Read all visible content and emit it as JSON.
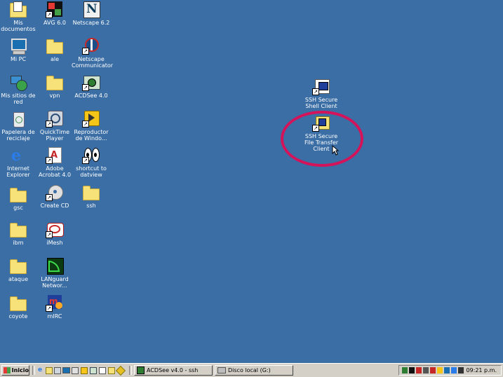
{
  "desktop": {
    "icons": [
      {
        "label": "Mis\ndocumentos",
        "icon": "my-documents-icon"
      },
      {
        "label": "Mi PC",
        "icon": "my-computer-icon"
      },
      {
        "label": "Mis sitios de\nred",
        "icon": "network-places-icon"
      },
      {
        "label": "Papelera de\nreciclaje",
        "icon": "recycle-bin-icon"
      },
      {
        "label": "Internet\nExplorer",
        "icon": "internet-explorer-icon"
      },
      {
        "label": "gsc",
        "icon": "folder-icon"
      },
      {
        "label": "ibm",
        "icon": "folder-icon"
      },
      {
        "label": "ataque",
        "icon": "folder-icon"
      },
      {
        "label": "coyote",
        "icon": "folder-icon"
      },
      {
        "label": "AVG 6.0",
        "icon": "avg-icon"
      },
      {
        "label": "ale",
        "icon": "folder-icon"
      },
      {
        "label": "vpn",
        "icon": "folder-icon"
      },
      {
        "label": "QuickTime\nPlayer",
        "icon": "quicktime-icon"
      },
      {
        "label": "Adobe\nAcrobat 4.0",
        "icon": "acrobat-icon"
      },
      {
        "label": "Create CD",
        "icon": "create-cd-icon"
      },
      {
        "label": "iMesh",
        "icon": "imesh-icon"
      },
      {
        "label": "LANguard\nNetwor...",
        "icon": "languard-icon"
      },
      {
        "label": "mIRC",
        "icon": "mirc-icon"
      },
      {
        "label": "Netscape 6.2",
        "icon": "netscape-icon"
      },
      {
        "label": "Netscape\nCommunicator",
        "icon": "netscape-communicator-icon"
      },
      {
        "label": "ACDSee 4.0",
        "icon": "acdsee-icon"
      },
      {
        "label": "Reproductor\nde Windo...",
        "icon": "media-player-icon"
      },
      {
        "label": "shortcut to\ndatview",
        "icon": "datview-icon"
      },
      {
        "label": "ssh",
        "icon": "folder-icon"
      },
      {
        "label": "SSH Secure\nShell Client",
        "icon": "ssh-shell-icon"
      },
      {
        "label": "SSH Secure\nFile Transfer\nClient",
        "icon": "ssh-file-transfer-icon"
      }
    ],
    "highlight_color": "#d4145a"
  },
  "taskbar": {
    "start_label": "Inicio",
    "tasks": [
      {
        "label": "ACDSee v4.0 - ssh"
      },
      {
        "label": "Disco local (G:)"
      }
    ],
    "clock": "09:21 p.m."
  }
}
